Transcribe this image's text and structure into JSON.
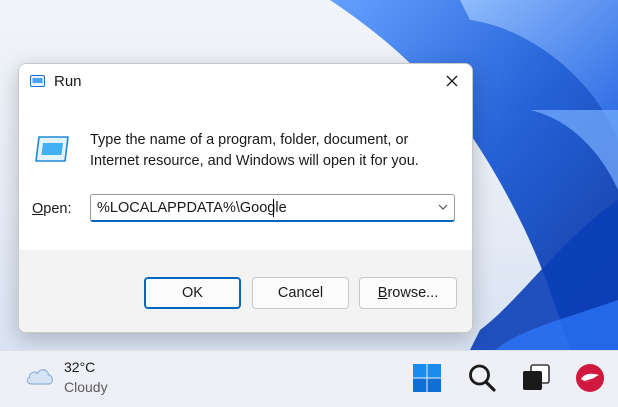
{
  "dialog": {
    "title": "Run",
    "description_line1": "Type the name of a program, folder, document, or",
    "description_line2": "Internet resource, and Windows will open it for you.",
    "open_label_prefix": "",
    "open_label_mnemonic": "O",
    "open_label_rest": "pen:",
    "open_value": "%LOCALAPPDATA%\\Google",
    "ok_label": "OK",
    "cancel_label": "Cancel",
    "browse_label_mnemonic": "B",
    "browse_label_rest": "rowse...",
    "icons": {
      "title": "run-icon",
      "main": "run-icon",
      "close": "close-icon",
      "dropdown": "chevron-down-icon"
    }
  },
  "taskbar": {
    "weather_temp": "32°C",
    "weather_condition": "Cloudy",
    "icons": [
      "cloud-icon",
      "windows-start-icon",
      "search-icon",
      "task-view-icon",
      "app-icon"
    ]
  },
  "colors": {
    "accent": "#0067c0",
    "wallpaper_blue": "#1a5bd6",
    "taskbar": "#eef0f5",
    "dialog_footer": "#f3f3f3",
    "app_icon_red": "#d0193f"
  }
}
